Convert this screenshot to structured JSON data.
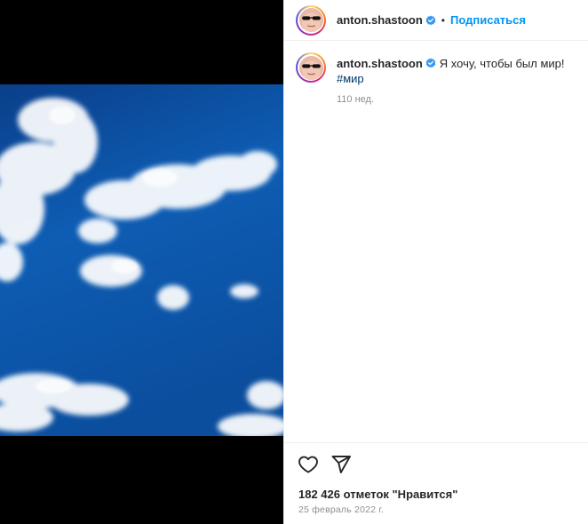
{
  "post": {
    "username": "anton.shastoon",
    "follow_label": "Подписаться",
    "separator": "•",
    "caption_text": "Я хочу, чтобы был мир!",
    "hashtag": "#мир",
    "time_ago": "110 нед.",
    "likes": "182 426 отметок \"Нравится\"",
    "date": "25 февраль 2022 г."
  },
  "icons": {
    "verified": "verified-badge-icon",
    "like": "heart-icon",
    "share": "paper-plane-icon"
  },
  "colors": {
    "accent": "#0095f6",
    "verified": "#3897f0",
    "hashtag": "#00376b",
    "muted": "#8e8e8e",
    "sky": "#0f5aa8"
  }
}
